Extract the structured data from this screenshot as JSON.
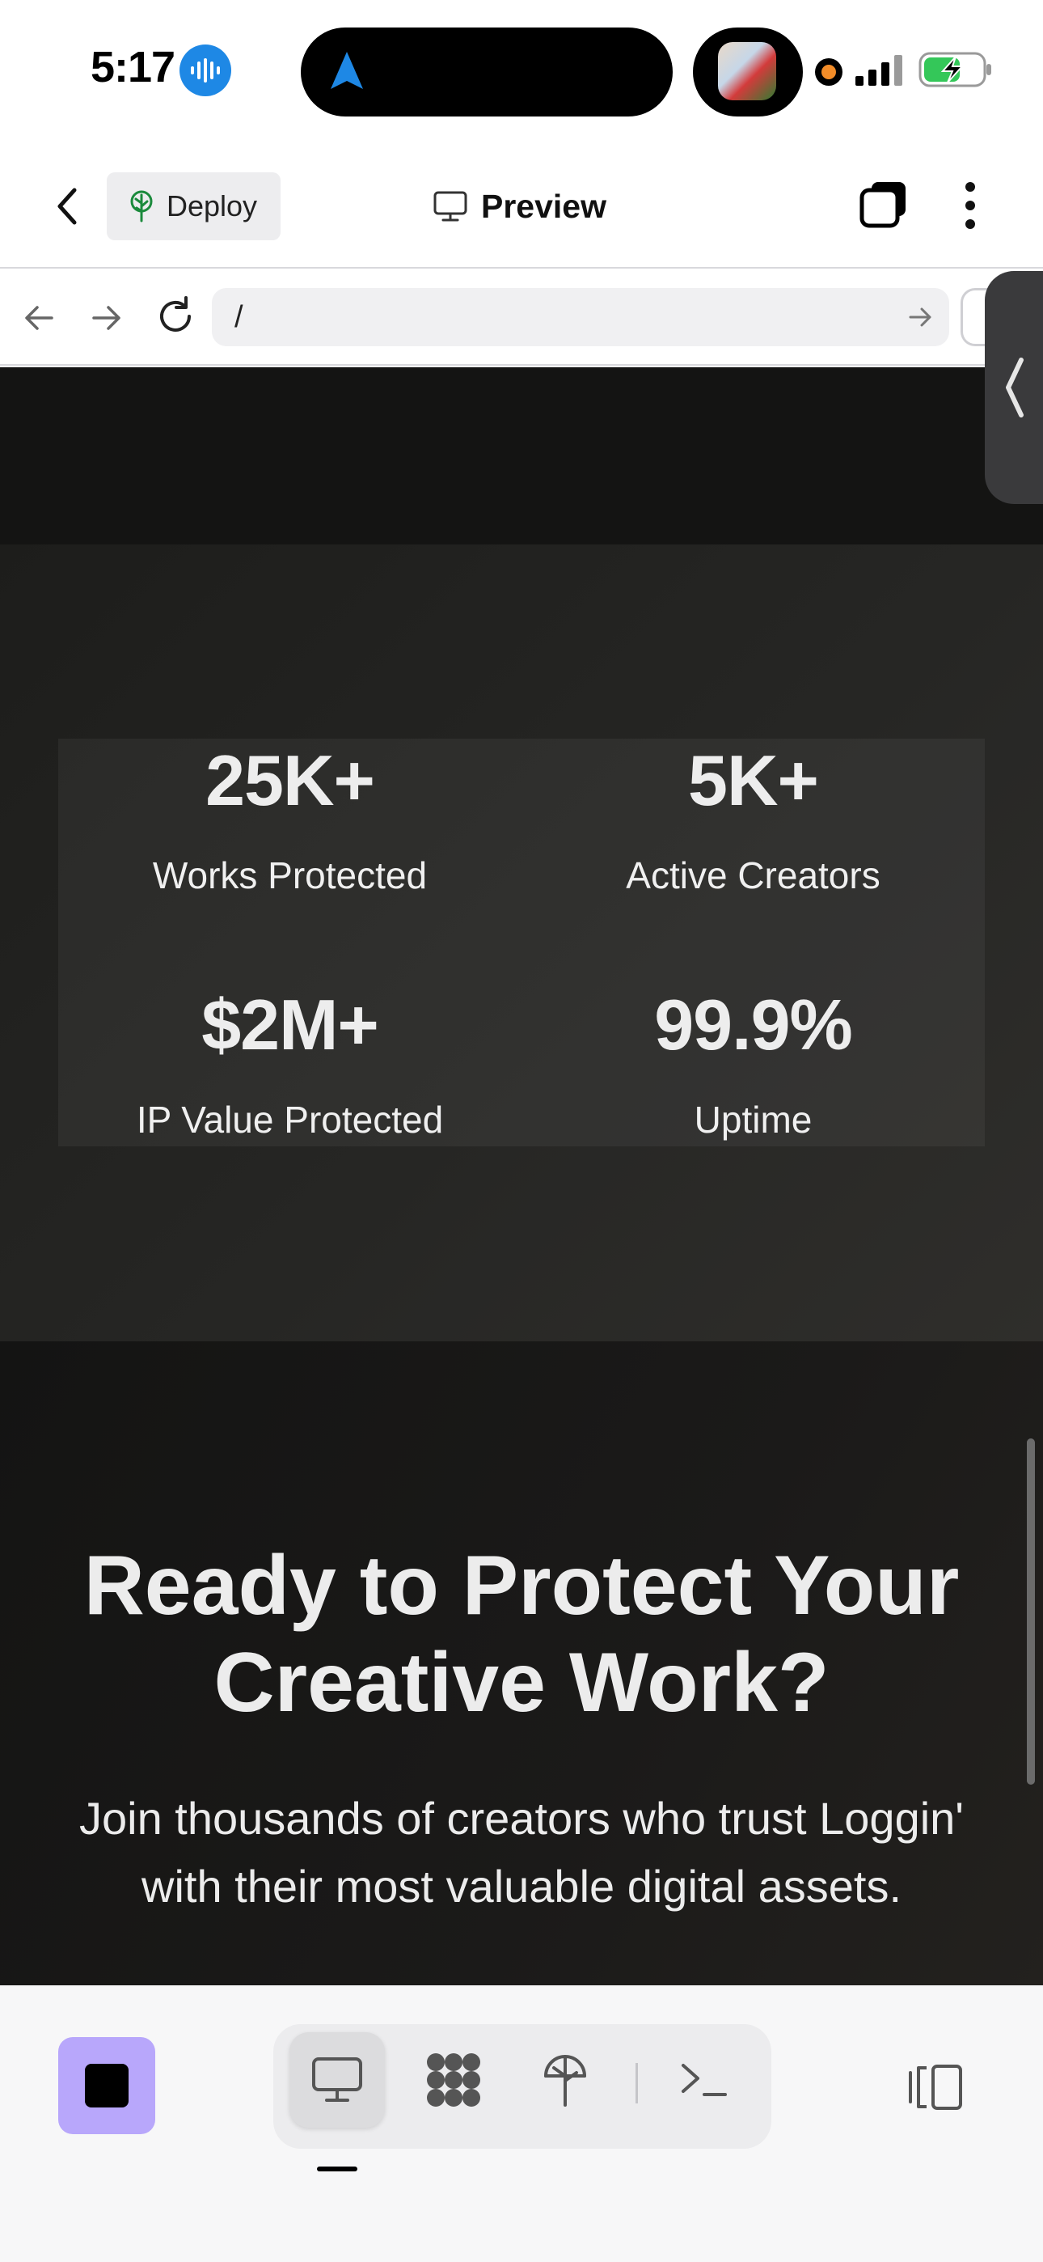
{
  "status_bar": {
    "time": "5:17",
    "icons": [
      "voice-recording-icon",
      "navigation-arrow-icon",
      "now-playing-thumbnail",
      "recording-dot-icon",
      "cellular-signal-icon",
      "battery-charging-icon"
    ]
  },
  "header": {
    "back_icon": "chevron-left-icon",
    "deploy_label": "Deploy",
    "deploy_icon": "tree-icon",
    "title": "Preview",
    "title_icon": "monitor-icon",
    "tabs_icon": "tabs-icon",
    "more_icon": "more-vertical-icon"
  },
  "browser": {
    "url": "/",
    "back_icon": "arrow-left-icon",
    "forward_icon": "arrow-right-icon",
    "reload_icon": "reload-icon",
    "go_icon": "arrow-right-icon"
  },
  "stats": [
    {
      "value": "25K+",
      "label": "Works Protected"
    },
    {
      "value": "5K+",
      "label": "Active Creators"
    },
    {
      "value": "$2M+",
      "label": "IP Value Protected"
    },
    {
      "value": "99.9%",
      "label": "Uptime"
    }
  ],
  "cta": {
    "title": "Ready to Protect Your Creative Work?",
    "subtitle": "Join thousands of creators who trust Loggin' with their most valuable digital assets."
  },
  "toolbar": {
    "stop_icon": "stop-icon",
    "segments": [
      "monitor-icon",
      "apps-icon",
      "deploy-icon",
      "terminal-icon"
    ],
    "active_segment": "monitor-icon",
    "panel_icon": "side-panel-icon"
  },
  "colors": {
    "accent": "#b8a7fb",
    "voice_blue": "#1e88e5",
    "battery_green": "#34c759",
    "page_dark": "#141413",
    "stats_bg": "#262624"
  }
}
